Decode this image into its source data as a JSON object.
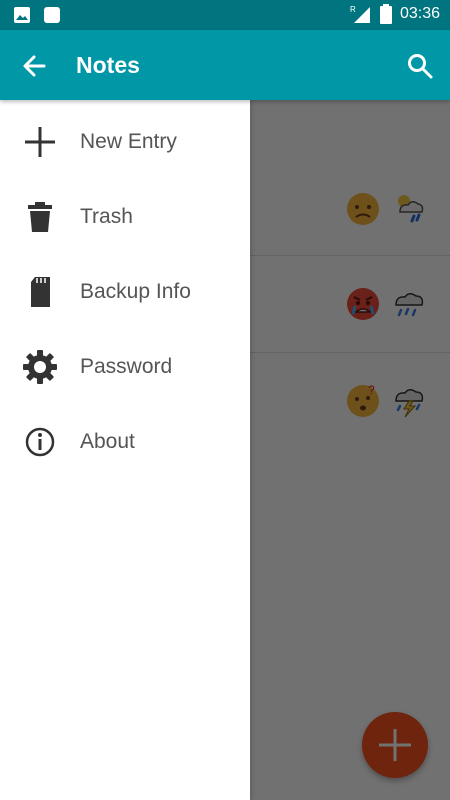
{
  "status_bar": {
    "time": "03:36",
    "network_badge": "R",
    "icons": [
      "image-icon",
      "square-notification-icon",
      "signal-icon",
      "battery-icon"
    ]
  },
  "app_bar": {
    "title": "Notes",
    "back_icon": "arrow-left-icon",
    "search_icon": "search-icon",
    "color": "#0097a7"
  },
  "drawer": {
    "items": [
      {
        "label": "New Entry",
        "icon": "plus-icon"
      },
      {
        "label": "Trash",
        "icon": "trash-icon"
      },
      {
        "label": "Backup Info",
        "icon": "sd-card-icon"
      },
      {
        "label": "Password",
        "icon": "gear-icon"
      },
      {
        "label": "About",
        "icon": "info-icon"
      }
    ]
  },
  "entries": [
    {
      "mood_icon": "sad-face-icon",
      "weather_icon": "partly-cloudy-rain-icon"
    },
    {
      "mood_icon": "angry-crying-face-icon",
      "weather_icon": "rain-cloud-icon"
    },
    {
      "mood_icon": "confused-face-icon",
      "weather_icon": "thunderstorm-icon"
    }
  ],
  "fab": {
    "icon": "plus-icon",
    "color": "#f4511e"
  },
  "colors": {
    "status_bar": "#00757f",
    "accent": "#0097a7",
    "fab": "#f4511e"
  }
}
